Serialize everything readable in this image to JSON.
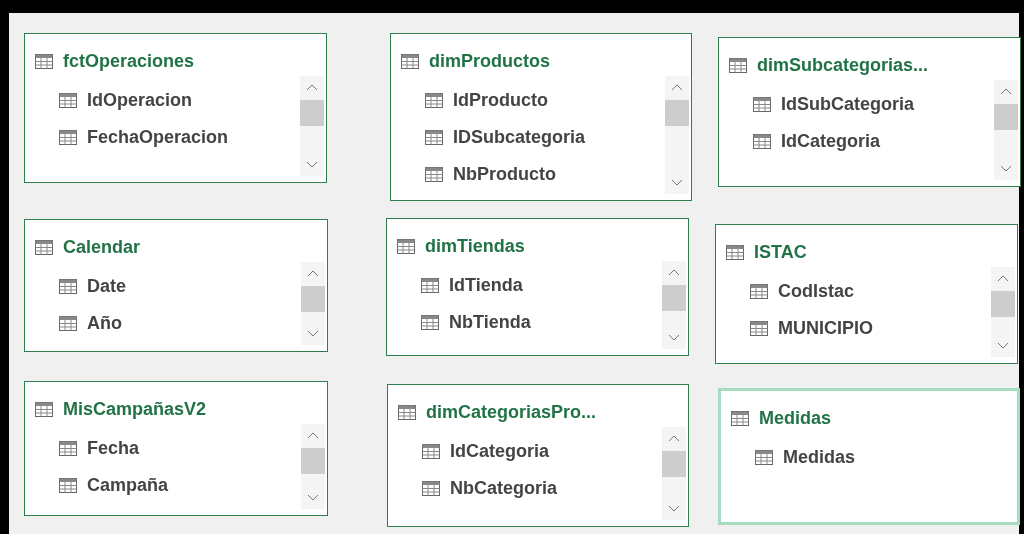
{
  "tables": [
    {
      "title": "fctOperaciones",
      "selected": false,
      "scrollbar": true,
      "fields": [
        "IdOperacion",
        "FechaOperacion"
      ]
    },
    {
      "title": "dimProductos",
      "selected": false,
      "scrollbar": true,
      "fields": [
        "IdProducto",
        "IDSubcategoria",
        "NbProducto"
      ]
    },
    {
      "title": "dimSubcategorias...",
      "selected": false,
      "scrollbar": true,
      "fields": [
        "IdSubCategoria",
        "IdCategoria"
      ]
    },
    {
      "title": "Calendar",
      "selected": false,
      "scrollbar": true,
      "fields": [
        "Date",
        "Año"
      ]
    },
    {
      "title": "dimTiendas",
      "selected": false,
      "scrollbar": true,
      "fields": [
        "IdTienda",
        "NbTienda"
      ]
    },
    {
      "title": "ISTAC",
      "selected": false,
      "scrollbar": true,
      "fields": [
        "CodIstac",
        "MUNICIPIO"
      ]
    },
    {
      "title": "MisCampañasV2",
      "selected": false,
      "scrollbar": true,
      "fields": [
        "Fecha",
        "Campaña"
      ]
    },
    {
      "title": "dimCategoriasPro...",
      "selected": false,
      "scrollbar": true,
      "fields": [
        "IdCategoria",
        "NbCategoria"
      ]
    },
    {
      "title": "Medidas",
      "selected": true,
      "scrollbar": false,
      "fields": [
        "Medidas"
      ]
    }
  ]
}
